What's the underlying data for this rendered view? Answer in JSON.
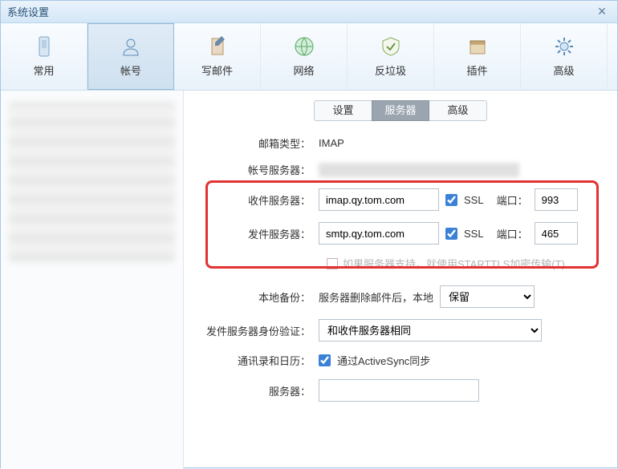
{
  "title": "系统设置",
  "toolbar": [
    {
      "label": "常用",
      "icon": "general"
    },
    {
      "label": "帐号",
      "icon": "account"
    },
    {
      "label": "写邮件",
      "icon": "compose"
    },
    {
      "label": "网络",
      "icon": "network"
    },
    {
      "label": "反垃圾",
      "icon": "spam"
    },
    {
      "label": "插件",
      "icon": "plugin"
    },
    {
      "label": "高级",
      "icon": "advanced"
    }
  ],
  "toolbar_active": 1,
  "subtabs": [
    "设置",
    "服务器",
    "高级"
  ],
  "subtabs_active": 1,
  "form": {
    "mailbox_type_label": "邮箱类型：",
    "mailbox_type_value": "IMAP",
    "account_server_label": "帐号服务器：",
    "recv_label": "收件服务器：",
    "recv_value": "imap.qy.tom.com",
    "recv_ssl": true,
    "recv_port_label": "端口：",
    "recv_port": "993",
    "send_label": "发件服务器：",
    "send_value": "smtp.qy.tom.com",
    "send_ssl": true,
    "send_port_label": "端口：",
    "send_port": "465",
    "ssl_label": "SSL",
    "starttls_label": "如果服务器支持，就使用STARTTLS加密传输(T)",
    "backup_label": "本地备份：",
    "backup_text": "服务器删除邮件后，本地",
    "backup_select": "保留",
    "auth_label": "发件服务器身份验证：",
    "auth_select": "和收件服务器相同",
    "contacts_label": "通讯录和日历：",
    "contacts_cb": true,
    "contacts_text": "通过ActiveSync同步",
    "server2_label": "服务器："
  }
}
